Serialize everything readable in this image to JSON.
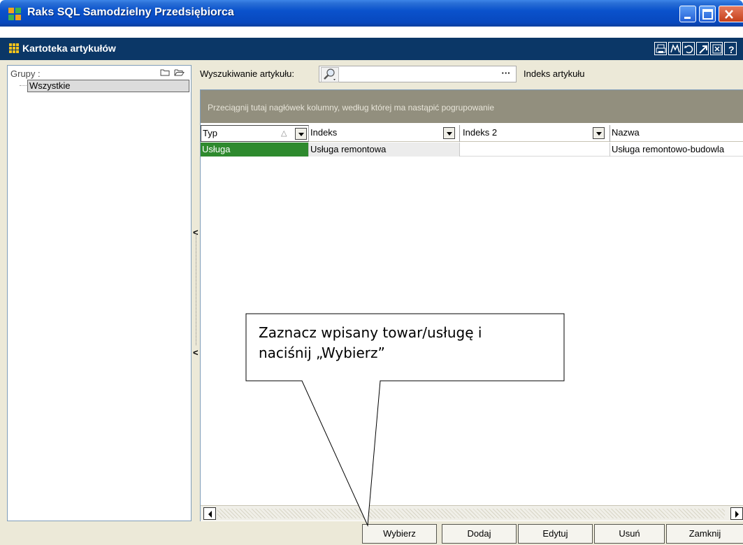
{
  "window": {
    "title": "Raks SQL Samodzielny Przedsiębiorca",
    "accent": "#0a52cc"
  },
  "subheader": {
    "title": "Kartoteka artykułów",
    "tools": [
      "print-icon",
      "filter-icon",
      "refresh-icon",
      "export-icon",
      "close-doc-icon",
      "help-icon"
    ]
  },
  "groups": {
    "label": "Grupy :",
    "items": [
      "Wszystkie"
    ]
  },
  "search": {
    "label": "Wyszukiwanie artykułu:",
    "value": "",
    "more": "···",
    "mode": "Indeks artykułu"
  },
  "grid": {
    "group_hint": "Przeciągnij tutaj nagłówek kolumny, według której ma nastąpić pogrupowanie",
    "columns": [
      "Typ",
      "Indeks",
      "Indeks 2",
      "Nazwa"
    ],
    "rows": [
      [
        "Usługa",
        "Usługa remontowa",
        "",
        "Usługa remontowo-budowla"
      ]
    ],
    "selected_color": "#2e8a2e"
  },
  "buttons": {
    "select": "Wybierz",
    "add": "Dodaj",
    "edit": "Edytuj",
    "delete": "Usuń",
    "close": "Zamknij"
  },
  "callout": {
    "line1": "Zaznacz wpisany towar/usługę i",
    "line2": "naciśnij „Wybierz”"
  }
}
